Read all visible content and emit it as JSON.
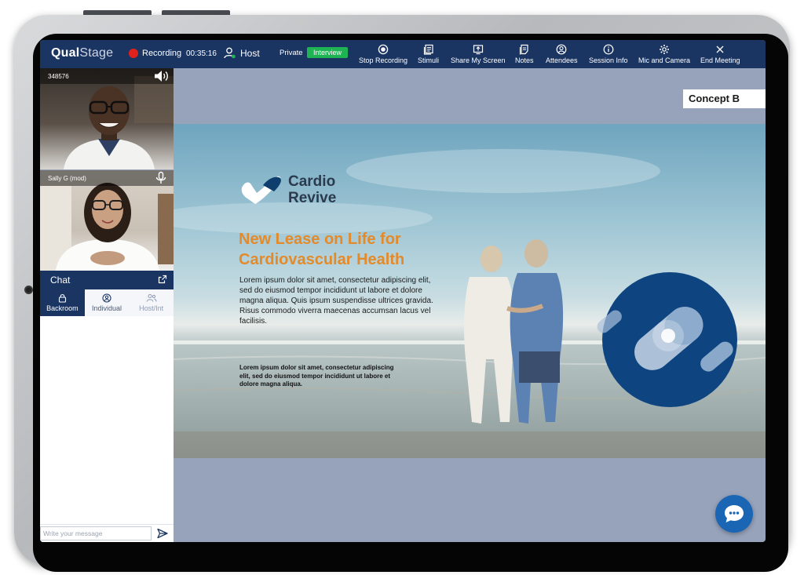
{
  "topbar": {
    "logo_main": "Qual",
    "logo_accent": "Stage",
    "recording_label": "Recording",
    "timer": "00:35:16",
    "role": "Host",
    "privacy": "Private",
    "session_type": "Interview",
    "actions": [
      {
        "label": "Stop Recording",
        "icon": "record-icon"
      },
      {
        "label": "Stimuli",
        "icon": "stimuli-icon"
      },
      {
        "label": "Share My Screen",
        "icon": "share-screen-icon"
      },
      {
        "label": "Notes",
        "icon": "notes-icon"
      },
      {
        "label": "Attendees",
        "icon": "attendees-icon"
      },
      {
        "label": "Session Info",
        "icon": "info-icon"
      },
      {
        "label": "Mic and Camera",
        "icon": "gear-icon"
      },
      {
        "label": "End Meeting",
        "icon": "close-icon"
      }
    ]
  },
  "videos": [
    {
      "name": "348576",
      "icon": "speaker-icon"
    },
    {
      "name": "Sally G (mod)",
      "icon": "mic-icon"
    }
  ],
  "chat": {
    "title": "Chat",
    "tabs": [
      {
        "label": "Backroom",
        "icon": "lock-icon"
      },
      {
        "label": "Individual",
        "icon": "user-icon"
      },
      {
        "label": "Host/Int",
        "icon": "users-icon"
      }
    ],
    "input_placeholder": "Write your message"
  },
  "stimulus": {
    "concept_label": "Concept B",
    "brand_line1": "Cardio",
    "brand_line2": "Revive",
    "headline_line1": "New Lease on Life for",
    "headline_line2": "Cardiovascular Health",
    "body": "Lorem ipsum dolor sit amet, consectetur adipiscing elit, sed do eiusmod tempor incididunt ut labore et dolore magna aliqua. Quis ipsum suspendisse ultrices gravida. Risus commodo viverra maecenas accumsan lacus vel facilisis.",
    "fine_print": "Lorem ipsum dolor sit amet, consectetur adipiscing elit, sed do eiusmod tempor incididunt ut labore et dolore magna aliqua."
  },
  "colors": {
    "topbar": "#1b3563",
    "recording_dot": "#e0221c",
    "interview_badge": "#1eb454",
    "headline": "#e38a2a",
    "stage_background": "#96a3bb",
    "chat_button": "#1a66b5"
  }
}
